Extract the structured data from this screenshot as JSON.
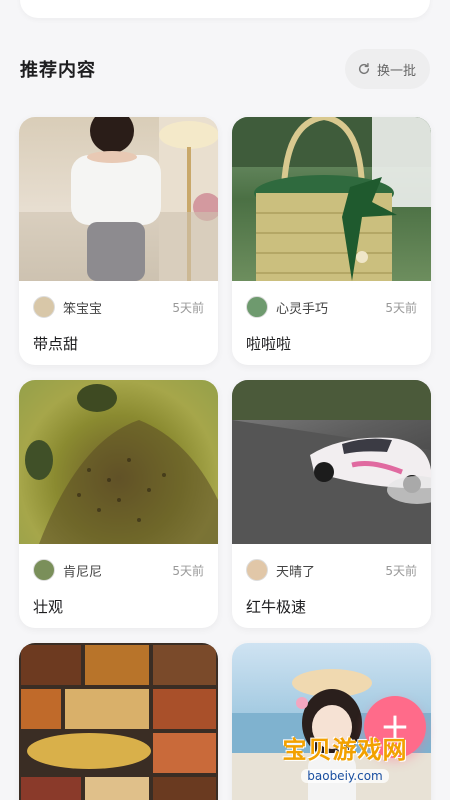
{
  "header": {
    "title": "推荐内容",
    "refresh_label": "换一批"
  },
  "cards": [
    {
      "author": "笨宝宝",
      "time": "5天前",
      "caption": "带点甜"
    },
    {
      "author": "心灵手巧",
      "time": "5天前",
      "caption": "啦啦啦"
    },
    {
      "author": "肯尼尼",
      "time": "5天前",
      "caption": "壮观"
    },
    {
      "author": "天晴了",
      "time": "5天前",
      "caption": "红牛极速"
    }
  ],
  "fab": {
    "label": "+"
  },
  "watermark": {
    "text": "宝贝游戏网",
    "url": "baobeiy.com"
  },
  "colors": {
    "accent": "#ff6b8a",
    "background": "#f6f6f8"
  },
  "icons": {
    "refresh": "refresh-icon"
  }
}
